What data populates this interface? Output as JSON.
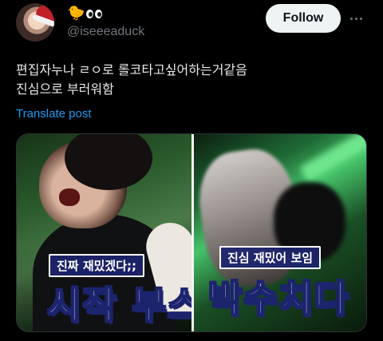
{
  "author": {
    "display_name_emoji": [
      "chick-emoji",
      "eyes-emoji"
    ],
    "handle": "@iseeeaduck",
    "avatar_icon": "avatar-santa-hat"
  },
  "header": {
    "follow_label": "Follow",
    "more_icon": "more-dots-icon"
  },
  "post": {
    "text": "편집자누나 ㄹㅇ로 롤코타고싶어하는거같음\n진심으로 부러워함",
    "translate_label": "Translate post"
  },
  "media": {
    "left_caption_small": "진짜 재밌겠다;;",
    "left_caption_big": "시작 부스",
    "right_caption_small": "진심 재밌어 보임",
    "right_caption_big": "박수치다"
  },
  "colors": {
    "background": "#000000",
    "link": "#1d9bf0",
    "muted": "#71767b",
    "caption_bg": "#1c246e"
  }
}
